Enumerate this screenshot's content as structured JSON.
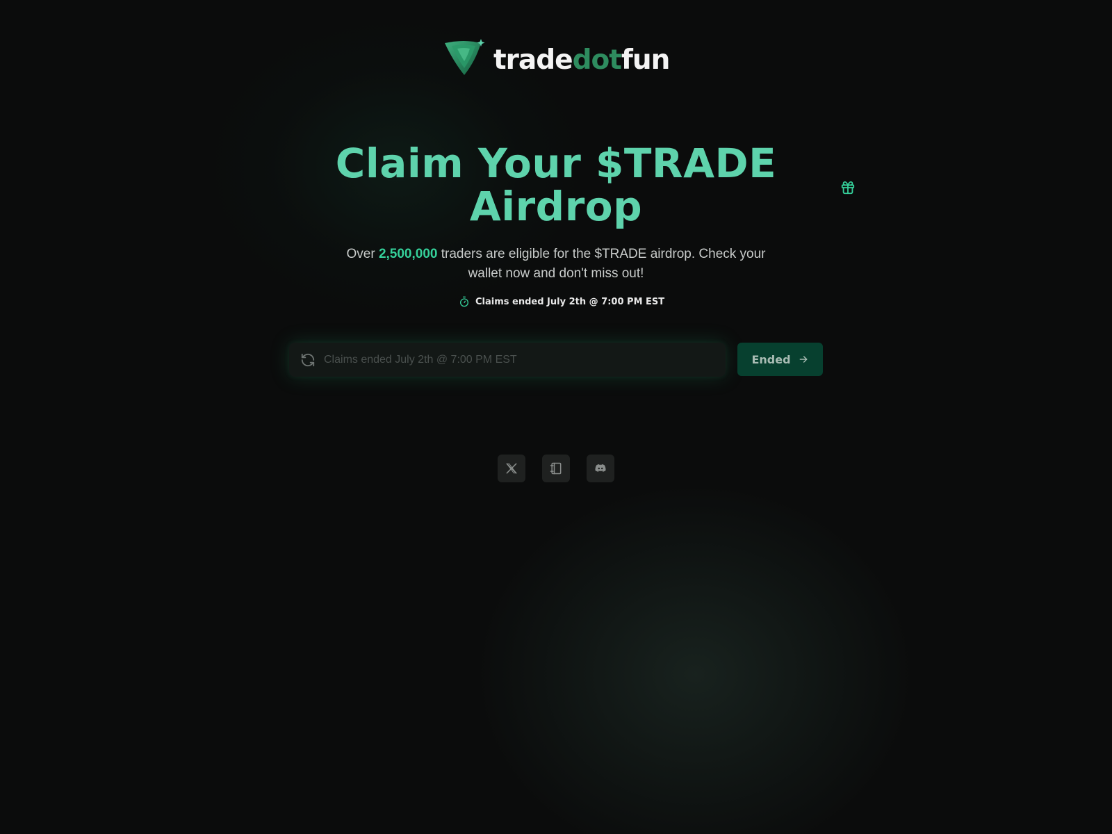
{
  "brand": {
    "part1": "trade",
    "part2": "dot",
    "part3": "fun",
    "logo_icon": "triangle-logo-icon"
  },
  "hero": {
    "title_line1": "Claim Your $TRADE",
    "title_line2": "Airdrop",
    "subtitle_prefix": "Over",
    "subtitle_highlight": "2,500,000",
    "subtitle_line1_suffix": "traders are eligible for the $TRADE airdrop. Check your",
    "subtitle_line2": "wallet now and don't miss out!",
    "deadline": "Claims ended July 2th @ 7:00 PM EST",
    "gift_icon": "gift-icon"
  },
  "claim": {
    "placeholder": "Claims ended July 2th @ 7:00 PM EST",
    "button_label": "Ended",
    "input_icon": "refresh-icon",
    "button_icon": "arrow-right-icon"
  },
  "social": [
    {
      "name": "x-icon"
    },
    {
      "name": "docs-icon"
    },
    {
      "name": "discord-icon"
    }
  ],
  "colors": {
    "background": "#0b0c0c",
    "accent": "#5ed3ac",
    "highlight": "#35d09a",
    "button_bg": "#07402f",
    "brand_dot": "#2e8c5f"
  }
}
